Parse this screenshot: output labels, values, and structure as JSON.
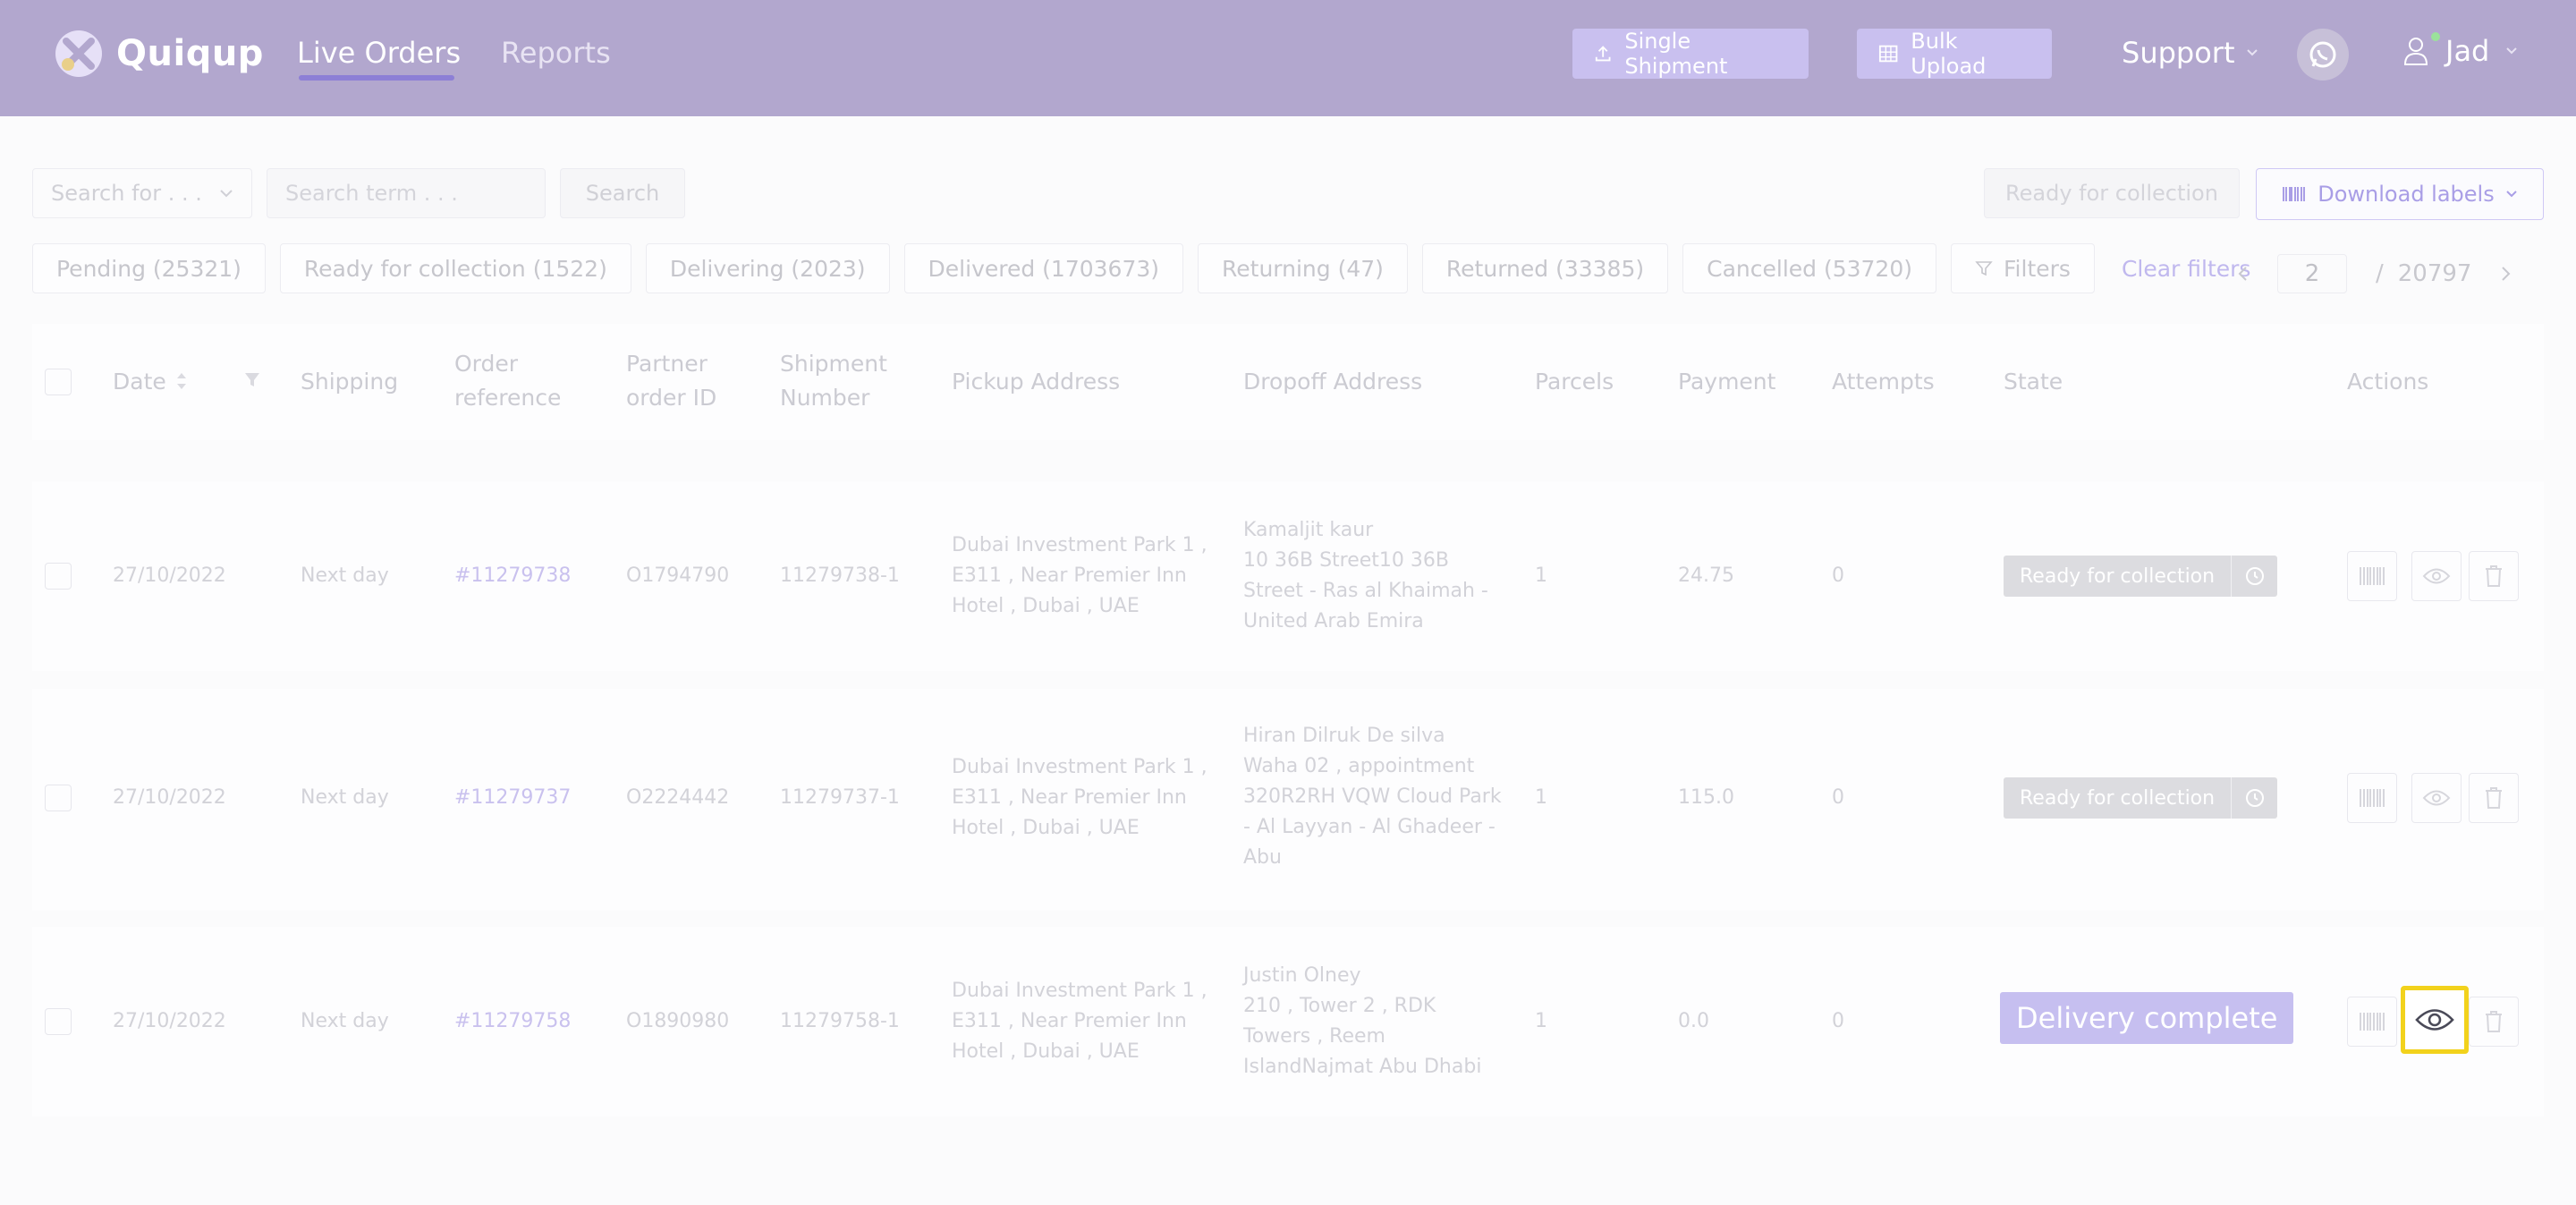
{
  "header": {
    "logo_text": "Quiqup",
    "nav_live": "Live Orders",
    "nav_reports": "Reports",
    "single_shipment": "Single Shipment",
    "bulk_upload": "Bulk Upload",
    "support": "Support",
    "user": "Jad"
  },
  "search": {
    "select_label": "Search for . . .",
    "term_placeholder": "Search term . . .",
    "button": "Search",
    "ready_button": "Ready for collection",
    "download_labels": "Download labels"
  },
  "tabs": [
    "Pending (25321)",
    "Ready for collection (1522)",
    "Delivering (2023)",
    "Delivered (1703673)",
    "Returning (47)",
    "Returned (33385)",
    "Cancelled (53720)"
  ],
  "filters": "Filters",
  "clear_filters": "Clear filters",
  "pager": {
    "current": "2",
    "separator": "/",
    "total": "20797"
  },
  "columns": {
    "date": "Date",
    "shipping": "Shipping",
    "order_ref_1": "Order",
    "order_ref_2": "reference",
    "partner_1": "Partner",
    "partner_2": "order ID",
    "shipment_1": "Shipment",
    "shipment_2": "Number",
    "pickup": "Pickup Address",
    "dropoff": "Dropoff Address",
    "parcels": "Parcels",
    "payment": "Payment",
    "attempts": "Attempts",
    "state": "State",
    "actions": "Actions"
  },
  "rows": [
    {
      "date": "27/10/2022",
      "shipping": "Next day",
      "order_ref": "#11279738",
      "partner_id": "O1794790",
      "shipment": "11279738-1",
      "pickup": [
        "Dubai Investment Park 1 ,",
        "E311 , Near Premier Inn",
        "Hotel , Dubai , UAE"
      ],
      "dropoff": [
        "Kamaljit kaur",
        "10 36B Street10 36B",
        "Street - Ras al Khaimah -",
        "United Arab Emira"
      ],
      "parcels": "1",
      "payment": "24.75",
      "attempts": "0",
      "state": "Ready for collection"
    },
    {
      "date": "27/10/2022",
      "shipping": "Next day",
      "order_ref": "#11279737",
      "partner_id": "O2224442",
      "shipment": "11279737-1",
      "pickup": [
        "Dubai Investment Park 1 ,",
        "E311 , Near Premier Inn",
        "Hotel , Dubai , UAE"
      ],
      "dropoff": [
        "Hiran Dilruk De silva",
        "Waha 02 , appointment",
        "320R2RH VQW Cloud Park",
        "- Al Layyan - Al Ghadeer -",
        "Abu"
      ],
      "parcels": "1",
      "payment": "115.0",
      "attempts": "0",
      "state": "Ready for collection"
    },
    {
      "date": "27/10/2022",
      "shipping": "Next day",
      "order_ref": "#11279758",
      "partner_id": "O1890980",
      "shipment": "11279758-1",
      "pickup": [
        "Dubai Investment Park 1 ,",
        "E311 , Near Premier Inn",
        "Hotel , Dubai , UAE"
      ],
      "dropoff": [
        "Justin Olney",
        "210 , Tower 2 , RDK",
        "Towers , Reem",
        "IslandNajmat Abu Dhabi"
      ],
      "parcels": "1",
      "payment": "0.0",
      "attempts": "0",
      "state": "Delivery complete"
    }
  ]
}
